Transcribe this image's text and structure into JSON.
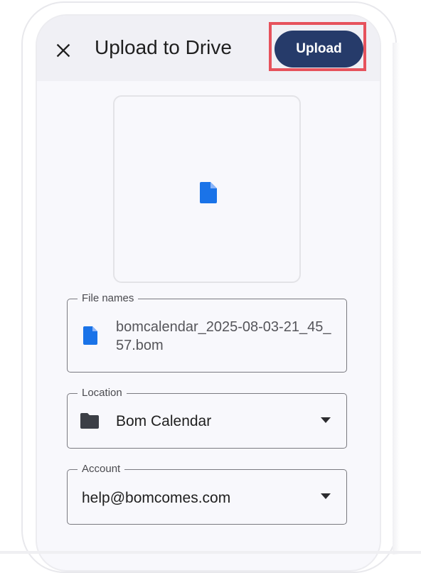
{
  "header": {
    "close_icon": "close-icon",
    "title": "Upload to Drive",
    "upload_label": "Upload"
  },
  "preview": {
    "icon": "file-icon"
  },
  "file_names": {
    "label": "File names",
    "icon": "file-icon",
    "value": "bomcalendar_2025-08-03-21_45_57.bom"
  },
  "location": {
    "label": "Location",
    "icon": "folder-icon",
    "value": "Bom Calendar",
    "dropdown_icon": "chevron-down-icon"
  },
  "account": {
    "label": "Account",
    "value": "help@bomcomes.com",
    "dropdown_icon": "chevron-down-icon"
  },
  "colors": {
    "accent": "#263b6a",
    "file_icon_blue": "#1a73e8",
    "highlight": "#e6525c"
  }
}
